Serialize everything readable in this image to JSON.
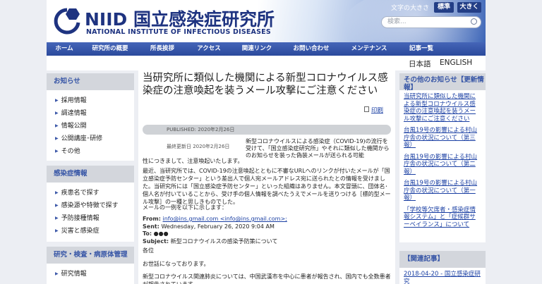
{
  "header": {
    "logo_text": "NIID 国立感染症研究所",
    "logo_subtitle": "NATIONAL INSTITUTE OF INFECTIOUS DISEASES",
    "font_size_label": "文字の大きさ",
    "font_standard": "標準",
    "font_large": "大きく",
    "search_placeholder": "検索..."
  },
  "nav": [
    "ホーム",
    "研究所の概要",
    "所長挨拶",
    "アクセス",
    "関連リンク",
    "お問い合わせ",
    "メンテナンス",
    "記事一覧"
  ],
  "lang": {
    "ja": "日本語",
    "en": "ENGLISH"
  },
  "left_sidebar": {
    "notice": {
      "title": "お知らせ",
      "items": [
        "採用情報",
        "調達情報",
        "情報公開",
        "公開講座･研修",
        "その他"
      ]
    },
    "infection": {
      "title": "感染症情報",
      "items": [
        "疾患名で探す",
        "感染源や特徴で探す",
        "予防接種情報",
        "災害と感染症"
      ]
    },
    "research": {
      "title": "研究・検査・病原体管理",
      "items": [
        "研究情報"
      ]
    }
  },
  "article": {
    "title": "当研究所に類似した機関による新型コロナウイルス感染症の注意喚起を装うメール攻撃にご注意ください",
    "print": "印刷",
    "published": "PUBLISHED: 2020年2月26日",
    "updated": "最終更新日 2020年2月26日",
    "p1_right": "新型コロナウイルスによる感染症（COVID-19)の流行を受けて、「国立感染症研究所」やそれに類似した機関からのお知らせを装った偽装メールが送られる可能",
    "p1_tail": "性につきまして、注意喚起いたします。",
    "p2": "最近、当研究所では、COVID-19の注意喚起とともに不審なURLへのリンクが付いたメールが「国立感染症予防センター」という差出人で個人宛メールアドレス宛に送られたとの情報を受けました。当研究所には「国立感染症予防センター」といった組織はありません。本文冒頭に、団体名･個人名が付いていることから、受け手の個人情報を調べたうえでメールを送りつける［標的型メール攻撃］の一種と思しきものでした。",
    "p3": "メールの一例を以下に示します：",
    "mail_from_label": "From:",
    "mail_from": "info@ins.gmail.com <info@ins.gmail.com>;",
    "mail_sent_label": "Sent:",
    "mail_sent": "Wednesday, February 26, 2020 9:04 AM",
    "mail_to_label": "To:",
    "mail_to": "●●●",
    "mail_subject_label": "Subject:",
    "mail_subject": "新型コロナウイルスの感染予防策について",
    "greet1": "各位",
    "greet2": "お世話になっております。",
    "p4": "新型コロナウイルス関連肺炎については、中国武漢市を中心に患者が報告され、国内でも全数患者が報告されています。"
  },
  "right_sidebar": {
    "other": {
      "title": "その他のお知らせ【更新情報】",
      "items": [
        "当研究所に類似した機関による新型コロナウイルス感染症の注意喚起を装うメール攻撃にご注意ください",
        "台風19号の影響による村山庁舎の状況について（第三報）",
        "台風19号の影響による村山庁舎の状況について（第二報）",
        "台風19号の影響による村山庁舎の状況について（第一報）",
        "「学校等欠席者・感染症情報システム」と「症候群サーベイランス」について"
      ]
    },
    "related": {
      "title": "【関連記事】",
      "items": [
        "2018-04-20 - 国立感染症研究"
      ]
    }
  }
}
